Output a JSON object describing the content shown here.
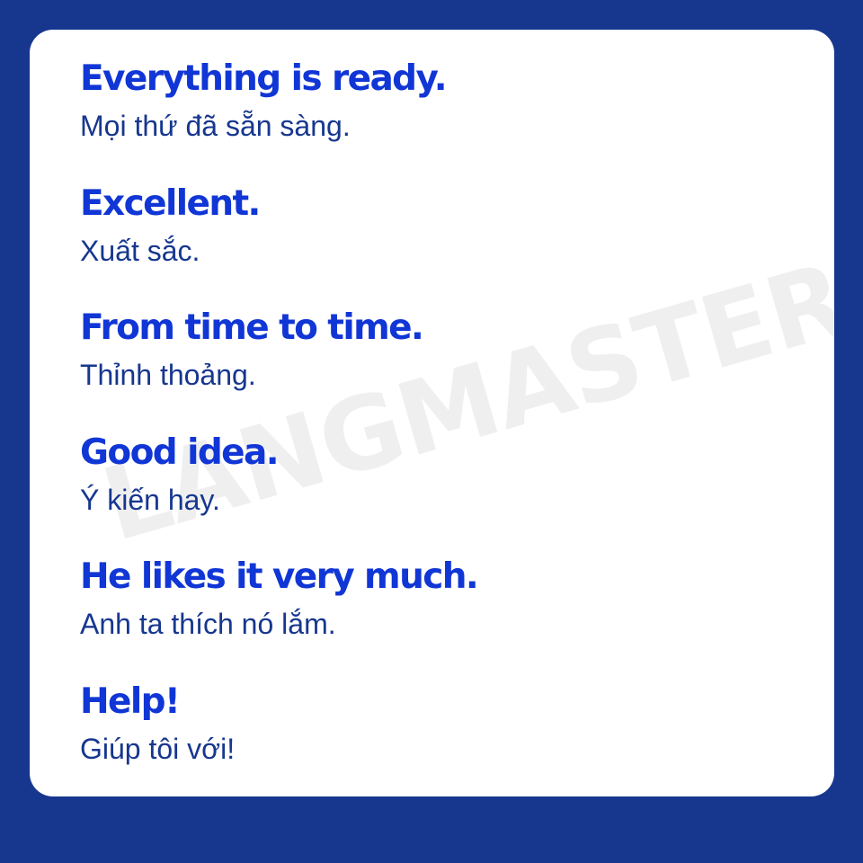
{
  "watermark": "LANGMASTER",
  "phrases": [
    {
      "english": "Everything is ready.",
      "vietnamese": "Mọi thứ đã sẵn sàng."
    },
    {
      "english": "Excellent.",
      "vietnamese": "Xuất sắc."
    },
    {
      "english": "From time to time.",
      "vietnamese": "Thỉnh thoảng."
    },
    {
      "english": "Good idea.",
      "vietnamese": "Ý kiến hay."
    },
    {
      "english": "He likes it very much.",
      "vietnamese": "Anh ta thích nó lắm."
    },
    {
      "english": "Help!",
      "vietnamese": "Giúp tôi với!"
    }
  ],
  "colors": {
    "background": "#17378f",
    "card": "#ffffff",
    "english_text": "#1136d6",
    "vietnamese_text": "#17378f"
  }
}
